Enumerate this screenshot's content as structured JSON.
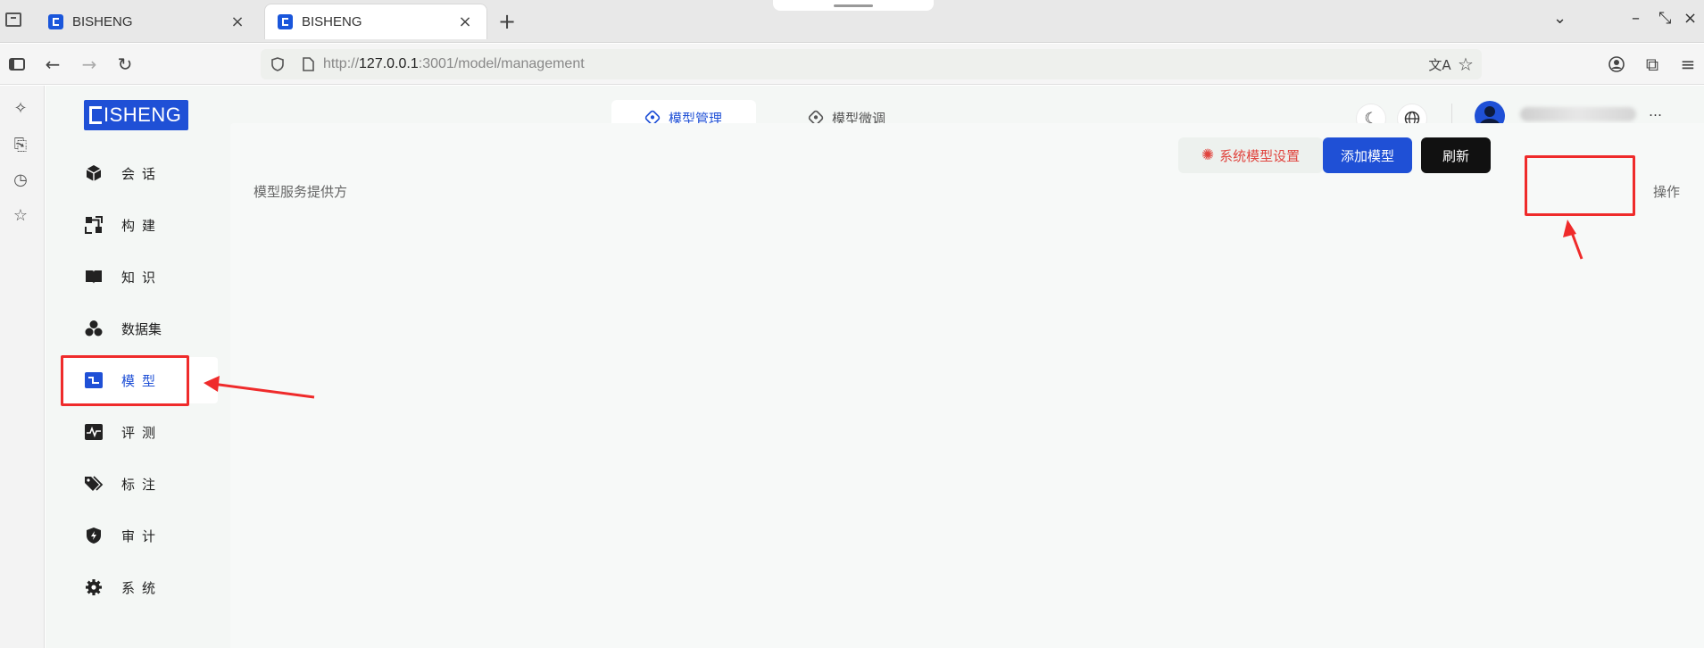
{
  "browser": {
    "tabs": [
      {
        "title": "BISHENG",
        "active": false
      },
      {
        "title": "BISHENG",
        "active": true
      }
    ],
    "url": {
      "scheme": "http://",
      "host": "127.0.0.1",
      "rest": ":3001/model/management"
    }
  },
  "app": {
    "logo": "ISHENG",
    "top_tabs": [
      {
        "label": "模型管理",
        "active": true
      },
      {
        "label": "模型微调",
        "active": false
      }
    ],
    "sidebar": [
      {
        "label": "会话",
        "icon": "cube-icon"
      },
      {
        "label": "构建",
        "icon": "build-icon"
      },
      {
        "label": "知识",
        "icon": "book-icon"
      },
      {
        "label": "数据集",
        "icon": "dataset-icon"
      },
      {
        "label": "模型",
        "icon": "model-icon",
        "active": true
      },
      {
        "label": "评测",
        "icon": "chart-pulse-icon"
      },
      {
        "label": "标注",
        "icon": "tag-icon"
      },
      {
        "label": "审计",
        "icon": "shield-icon"
      },
      {
        "label": "系统",
        "icon": "gear-icon"
      }
    ],
    "toolbar": {
      "system_model_settings": "系统模型设置",
      "add_model": "添加模型",
      "refresh": "刷新"
    },
    "table": {
      "columns": [
        "模型服务提供方",
        "操作"
      ]
    }
  },
  "colors": {
    "accent": "#1f50d6",
    "danger": "#e0443e",
    "annotation": "#ef2b2b"
  }
}
